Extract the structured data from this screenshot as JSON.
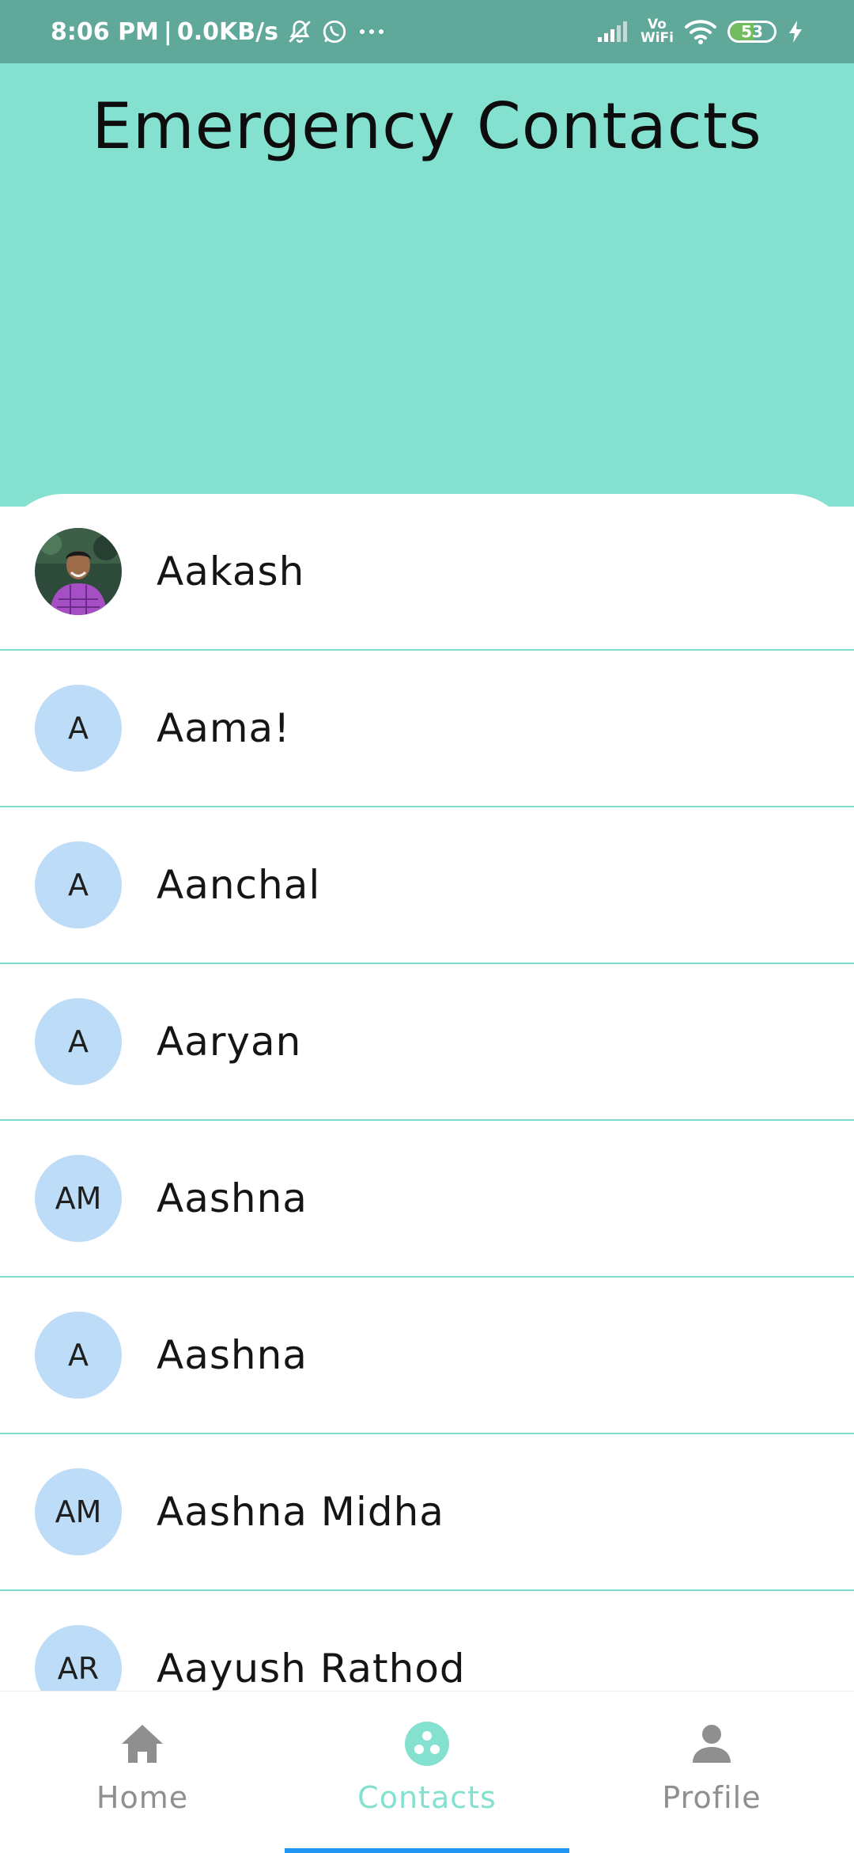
{
  "status_bar": {
    "time": "8:06 PM",
    "separator": "|",
    "network_speed": "0.0KB/s",
    "icons": [
      "mute-icon",
      "whatsapp-icon",
      "more-icon"
    ],
    "right_icons": [
      "signal-icon",
      "vowifi-icon",
      "wifi-icon",
      "battery-icon",
      "charging-icon"
    ],
    "vowifi_top": "Vo",
    "vowifi_bottom": "WiFi",
    "battery_level": "53"
  },
  "header": {
    "title": "Emergency Contacts",
    "background": "#84e1d0"
  },
  "contacts": [
    {
      "name": "Aakash",
      "initials": "",
      "has_photo": true
    },
    {
      "name": "Aama!",
      "initials": "A",
      "has_photo": false
    },
    {
      "name": "Aanchal",
      "initials": "A",
      "has_photo": false
    },
    {
      "name": "Aaryan",
      "initials": "A",
      "has_photo": false
    },
    {
      "name": "Aashna",
      "initials": "AM",
      "has_photo": false
    },
    {
      "name": "Aashna",
      "initials": "A",
      "has_photo": false
    },
    {
      "name": "Aashna Midha",
      "initials": "AM",
      "has_photo": false
    },
    {
      "name": "Aayush Rathod",
      "initials": "AR",
      "has_photo": false
    }
  ],
  "bottom_nav": {
    "items": [
      {
        "label": "Home",
        "icon": "home-icon",
        "active": false
      },
      {
        "label": "Contacts",
        "icon": "contacts-icon",
        "active": true
      },
      {
        "label": "Profile",
        "icon": "profile-icon",
        "active": false
      }
    ],
    "active_color": "#84e1d0",
    "indicator_color": "#2196f3"
  },
  "colors": {
    "status_bar": "#5fa89a",
    "avatar_bg": "#bcdcf7",
    "divider": "#7fdac9"
  }
}
